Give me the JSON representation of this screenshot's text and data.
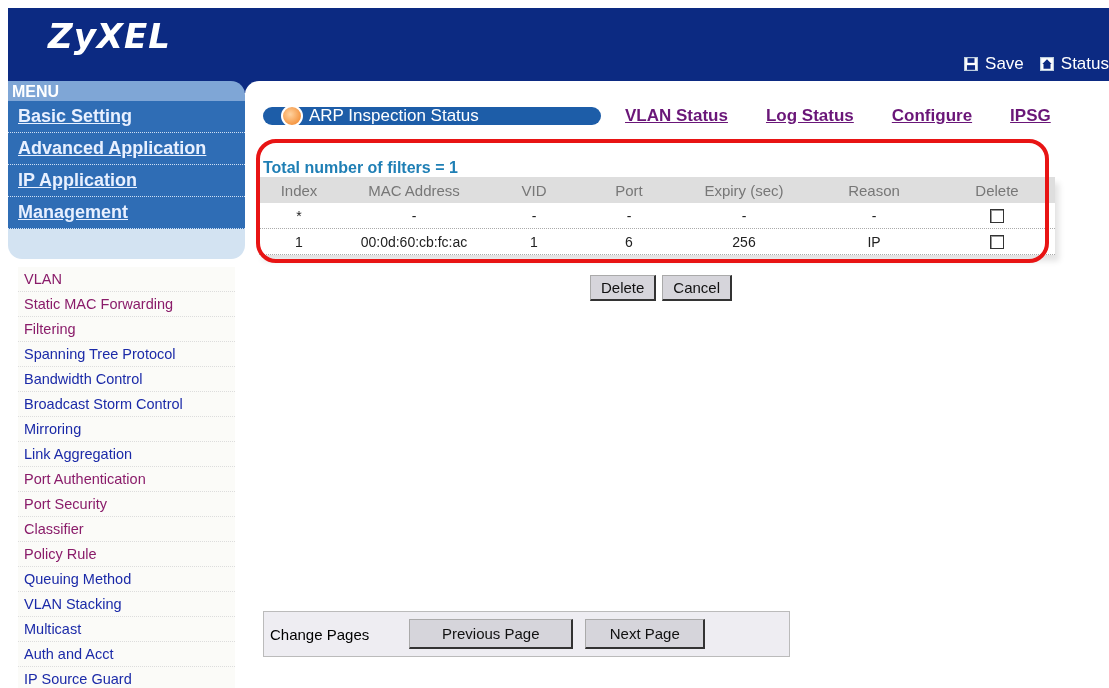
{
  "header": {
    "logo": "ZyXEL",
    "actions": [
      {
        "kind": "save",
        "label": "Save"
      },
      {
        "kind": "status",
        "label": "Status"
      }
    ]
  },
  "menu": {
    "title": "MENU",
    "items": [
      "Basic Setting",
      "Advanced Application",
      "IP Application",
      "Management"
    ]
  },
  "submenu": [
    {
      "label": "VLAN",
      "visited": true
    },
    {
      "label": "Static MAC Forwarding",
      "visited": true
    },
    {
      "label": "Filtering",
      "visited": true
    },
    {
      "label": "Spanning Tree Protocol",
      "visited": false
    },
    {
      "label": "Bandwidth Control",
      "visited": false
    },
    {
      "label": "Broadcast Storm Control",
      "visited": false
    },
    {
      "label": "Mirroring",
      "visited": false
    },
    {
      "label": "Link Aggregation",
      "visited": false
    },
    {
      "label": "Port Authentication",
      "visited": true
    },
    {
      "label": "Port Security",
      "visited": true
    },
    {
      "label": "Classifier",
      "visited": true
    },
    {
      "label": "Policy Rule",
      "visited": true
    },
    {
      "label": "Queuing Method",
      "visited": false
    },
    {
      "label": "VLAN Stacking",
      "visited": false
    },
    {
      "label": "Multicast",
      "visited": false
    },
    {
      "label": "Auth and Acct",
      "visited": false
    },
    {
      "label": "IP Source Guard",
      "visited": false
    }
  ],
  "tabs": [
    {
      "label": "ARP Inspection Status",
      "selected": true
    },
    {
      "label": "VLAN Status",
      "selected": false
    },
    {
      "label": "Log Status",
      "selected": false
    },
    {
      "label": "Configure",
      "selected": false
    },
    {
      "label": "IPSG",
      "selected": false
    }
  ],
  "summary": "Total number of filters = 1",
  "table": {
    "columns": [
      "Index",
      "MAC Address",
      "VID",
      "Port",
      "Expiry (sec)",
      "Reason",
      "Delete"
    ],
    "rows": [
      {
        "cells": [
          "*",
          "-",
          "-",
          "-",
          "-",
          "-"
        ],
        "checked": false
      },
      {
        "cells": [
          "1",
          "00:0d:60:cb:fc:ac",
          "1",
          "6",
          "256",
          "IP"
        ],
        "checked": false
      }
    ]
  },
  "buttons": [
    "Delete",
    "Cancel"
  ],
  "pager": {
    "label": "Change Pages",
    "buttons": [
      "Previous Page",
      "Next Page"
    ]
  }
}
